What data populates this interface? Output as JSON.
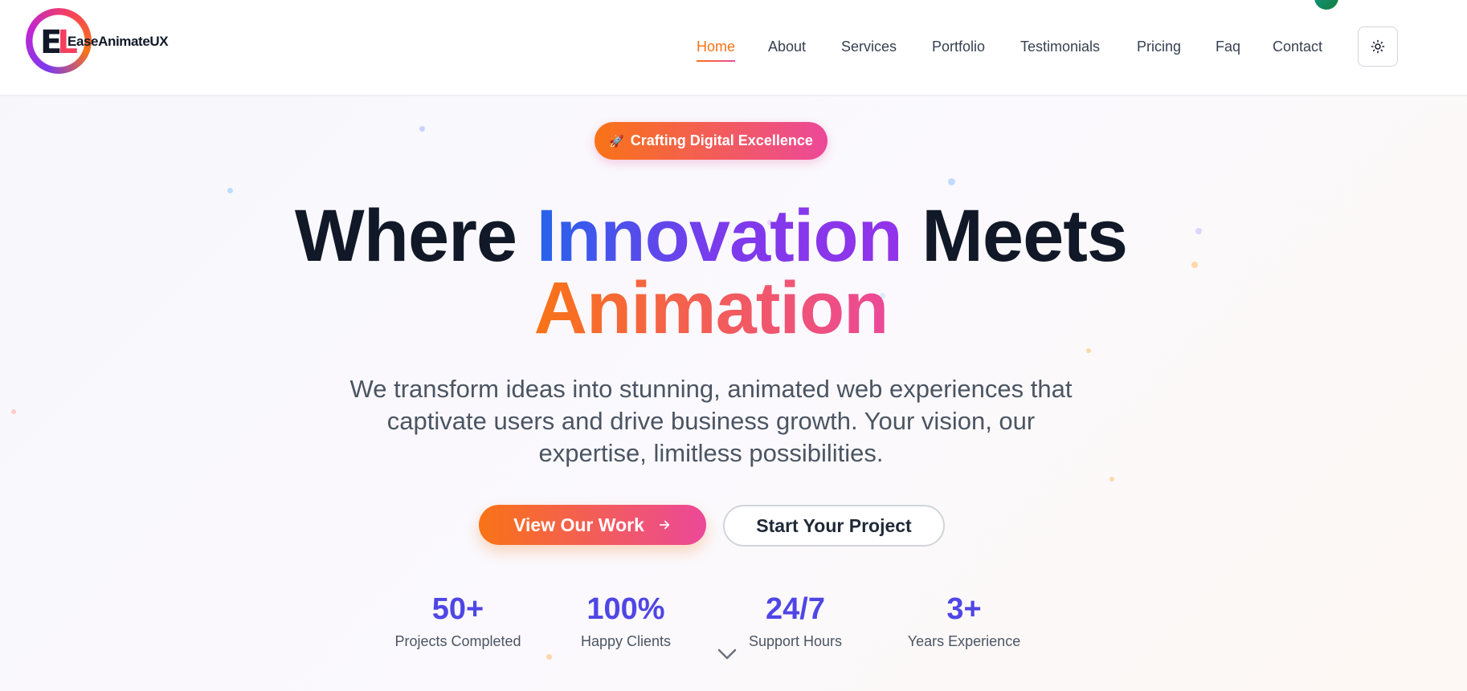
{
  "brand": {
    "name": "EaseAnimateUX",
    "mark_letter_1": "E",
    "mark_letter_2": "L"
  },
  "nav": {
    "items": [
      {
        "label": "Home",
        "active": true
      },
      {
        "label": "About"
      },
      {
        "label": "Services"
      },
      {
        "label": "Portfolio"
      },
      {
        "label": "Testimonials"
      },
      {
        "label": "Pricing"
      },
      {
        "label": "Faq"
      },
      {
        "label": "Contact"
      }
    ],
    "theme_toggle_icon": "sun-icon"
  },
  "hero": {
    "badge_icon": "rocket-icon",
    "badge_emoji": "🚀",
    "badge_label": "Crafting Digital Excellence",
    "headline": {
      "part1": "Where ",
      "part2": "Innovation",
      "part3": " Meets",
      "line2": "Animation"
    },
    "subtitle": "We transform ideas into stunning, animated web experiences that captivate users and drive business growth. Your vision, our expertise, limitless possibilities.",
    "primary_cta": {
      "label": "View Our Work",
      "icon": "arrow-right-icon"
    },
    "secondary_cta": {
      "label": "Start Your Project"
    }
  },
  "stats": [
    {
      "value": "50+",
      "label": "Projects Completed"
    },
    {
      "value": "100%",
      "label": "Happy Clients"
    },
    {
      "value": "24/7",
      "label": "Support Hours"
    },
    {
      "value": "3+",
      "label": "Years Experience"
    }
  ],
  "scroll_indicator_icon": "chevron-down-icon",
  "colors": {
    "accent_orange": "#f97316",
    "accent_pink": "#ec4899",
    "accent_blue": "#2563eb",
    "accent_purple": "#7c3aed",
    "stat_color": "#4f46e5"
  }
}
